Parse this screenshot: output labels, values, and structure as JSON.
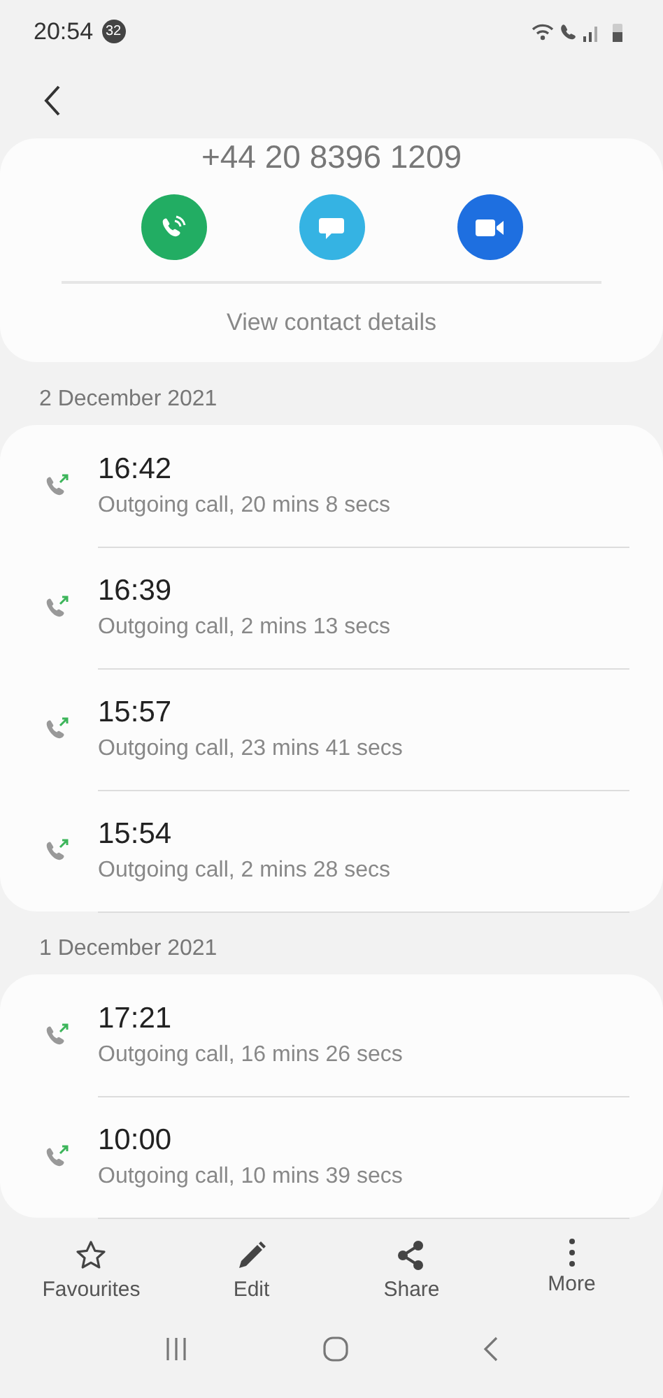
{
  "status_bar": {
    "time": "20:54",
    "notification_count": "32"
  },
  "contact": {
    "number": "+44 20 8396 1209",
    "link": "View contact details"
  },
  "groups": [
    {
      "date": "2 December 2021",
      "calls": [
        {
          "time": "16:42",
          "detail": "Outgoing call, 20 mins 8 secs"
        },
        {
          "time": "16:39",
          "detail": "Outgoing call, 2 mins 13 secs"
        },
        {
          "time": "15:57",
          "detail": "Outgoing call, 23 mins 41 secs"
        },
        {
          "time": "15:54",
          "detail": "Outgoing call, 2 mins 28 secs"
        }
      ]
    },
    {
      "date": "1 December 2021",
      "calls": [
        {
          "time": "17:21",
          "detail": "Outgoing call, 16 mins 26 secs"
        },
        {
          "time": "10:00",
          "detail": "Outgoing call, 10 mins 39 secs"
        }
      ]
    }
  ],
  "toolbar": [
    {
      "kind": "star",
      "label": "Favourites"
    },
    {
      "kind": "pencil",
      "label": "Edit"
    },
    {
      "kind": "share",
      "label": "Share"
    },
    {
      "kind": "more",
      "label": "More"
    }
  ]
}
